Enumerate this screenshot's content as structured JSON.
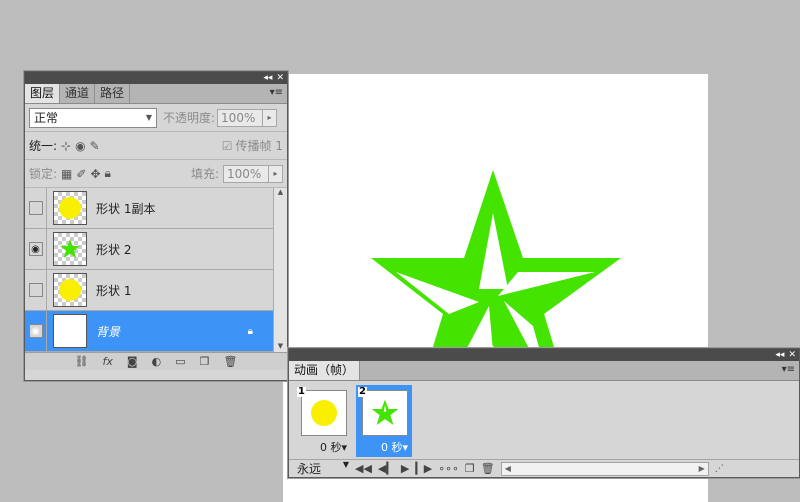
{
  "layers_panel": {
    "tabs": [
      "图层",
      "通道",
      "路径"
    ],
    "blend_mode": "正常",
    "opacity_label": "不透明度:",
    "opacity_value": "100%",
    "unify_label": "统一:",
    "propagate_label": "传播帧 1",
    "lock_label": "锁定:",
    "fill_label": "填充:",
    "fill_value": "100%",
    "layers": [
      {
        "name": "形状 1副本",
        "visible": false,
        "thumb": "yellow-circle"
      },
      {
        "name": "形状 2",
        "visible": true,
        "thumb": "green-star"
      },
      {
        "name": "形状 1",
        "visible": false,
        "thumb": "yellow-circle"
      },
      {
        "name": "背景",
        "visible": true,
        "thumb": "white",
        "selected": true,
        "locked": true
      }
    ]
  },
  "animation_panel": {
    "tab": "动画（帧）",
    "frames": [
      {
        "number": "1",
        "delay": "0 秒",
        "thumb": "yellow-circle"
      },
      {
        "number": "2",
        "delay": "0 秒",
        "thumb": "green-star",
        "selected": true
      }
    ],
    "loop_option": "永远"
  },
  "colors": {
    "star_green": "#44e400",
    "circle_yellow": "#f8f000",
    "selection_blue": "#3d94f6"
  }
}
